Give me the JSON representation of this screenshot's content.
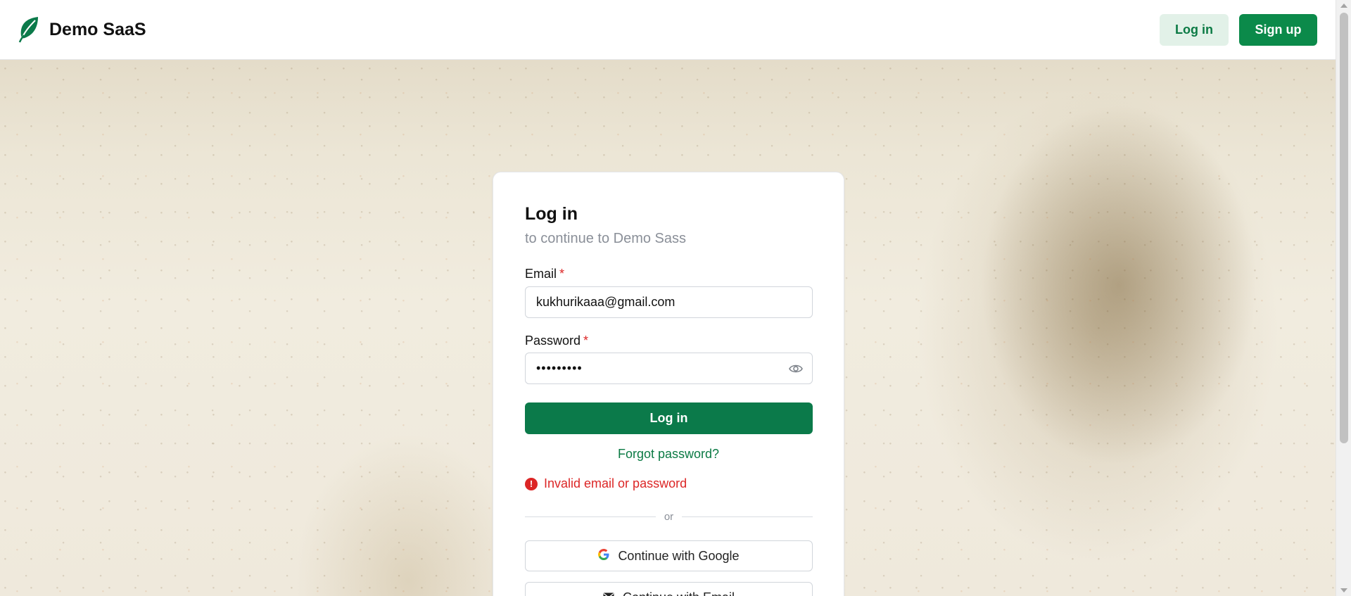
{
  "header": {
    "brand_name": "Demo SaaS",
    "login_label": "Log in",
    "signup_label": "Sign up"
  },
  "colors": {
    "brand_green": "#0b7a4a",
    "error_red": "#dc2626"
  },
  "card": {
    "title": "Log in",
    "subtitle": "to continue to Demo Sass",
    "email_label": "Email",
    "email_value": "kukhurikaaa@gmail.com",
    "password_label": "Password",
    "password_value": "•••••••••",
    "required_mark": "*",
    "submit_label": "Log in",
    "forgot_label": "Forgot password?",
    "error_message": "Invalid email or password",
    "divider_text": "or",
    "google_label": "Continue with Google",
    "email_oauth_label": "Continue with Email"
  },
  "icons": {
    "logo": "leaf-icon",
    "eye": "eye-icon",
    "error": "alert-circle-icon",
    "google": "google-icon",
    "mail": "mail-icon"
  }
}
